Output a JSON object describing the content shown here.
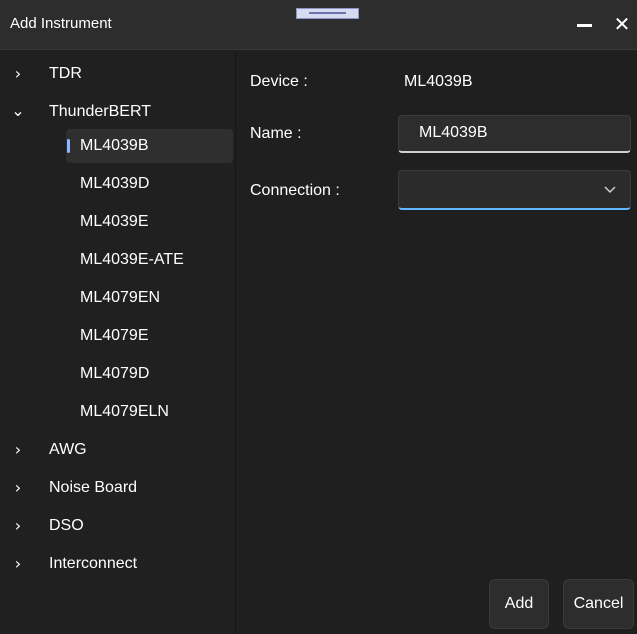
{
  "window": {
    "title": "Add Instrument",
    "minimize_label": "—",
    "close_label": "✕"
  },
  "sidebar": {
    "items": [
      {
        "label": "TDR",
        "expanded": false
      },
      {
        "label": "ThunderBERT",
        "expanded": true
      },
      {
        "label": "ML4039B",
        "selected": true,
        "parent": "ThunderBERT"
      },
      {
        "label": "ML4039D",
        "parent": "ThunderBERT"
      },
      {
        "label": "ML4039E",
        "parent": "ThunderBERT"
      },
      {
        "label": "ML4039E-ATE",
        "parent": "ThunderBERT"
      },
      {
        "label": "ML4079EN",
        "parent": "ThunderBERT"
      },
      {
        "label": "ML4079E",
        "parent": "ThunderBERT"
      },
      {
        "label": "ML4079D",
        "parent": "ThunderBERT"
      },
      {
        "label": "ML4079ELN",
        "parent": "ThunderBERT"
      },
      {
        "label": "AWG",
        "expanded": false
      },
      {
        "label": "Noise Board",
        "expanded": false
      },
      {
        "label": "DSO",
        "expanded": false
      },
      {
        "label": "Interconnect",
        "expanded": false
      }
    ]
  },
  "form": {
    "device_label": "Device :",
    "device_value": "ML4039B",
    "name_label": "Name :",
    "name_value": "ML4039B",
    "connection_label": "Connection :",
    "connection_value": ""
  },
  "buttons": {
    "add_label": "Add",
    "cancel_label": "Cancel"
  },
  "colors": {
    "background": "#1f1f1f",
    "titlebar": "#2d2d2d",
    "accent": "#62b8ff",
    "selection_indicator": "#8cb7ff",
    "button": "#2d2d2d",
    "text": "#ffffff"
  },
  "icons": {
    "collapsed": "chevron-right-icon",
    "expanded": "chevron-down-icon",
    "minimize": "minimize-icon",
    "close": "close-icon",
    "drag": "drag-handle-icon"
  }
}
